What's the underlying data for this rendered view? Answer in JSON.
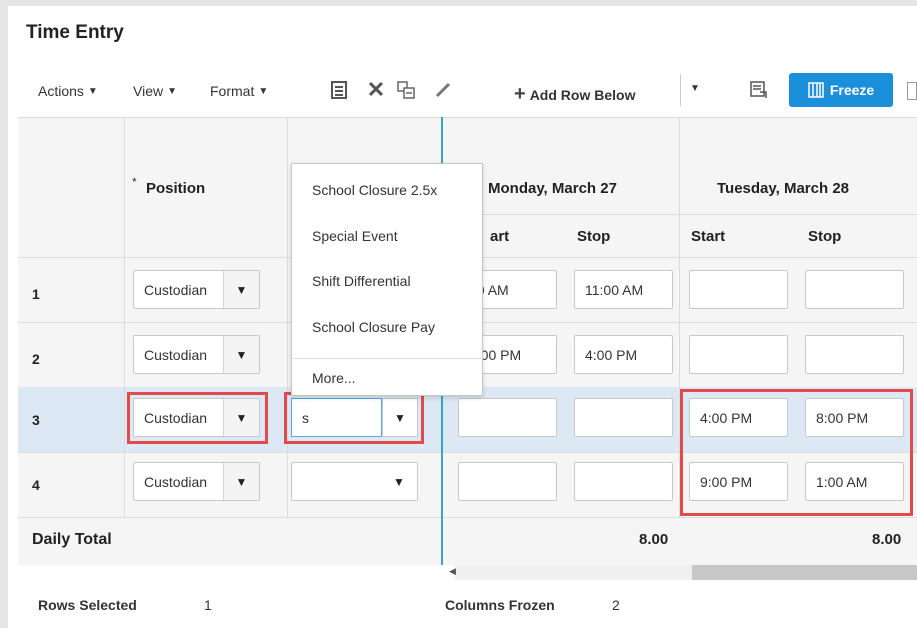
{
  "title": "Time Entry",
  "toolbar": {
    "actions": "Actions",
    "view": "View",
    "format": "Format",
    "add_row_below": "Add Row Below",
    "freeze": "Freeze"
  },
  "table": {
    "position_header": "Position",
    "required_marker": "*",
    "day1": "Monday, March 27",
    "day2": "Tuesday, March 28",
    "start": "Start",
    "stop": "Stop",
    "start_partial": "art",
    "rows": [
      {
        "num": "1",
        "position": "Custodian",
        "mon_start": "00 AM",
        "mon_stop": "11:00 AM",
        "tue_start": "",
        "tue_stop": ""
      },
      {
        "num": "2",
        "position": "Custodian",
        "mon_start": "2:00 PM",
        "mon_stop": "4:00 PM",
        "tue_start": "",
        "tue_stop": ""
      },
      {
        "num": "3",
        "position": "Custodian",
        "type_input": "s",
        "mon_start": "",
        "mon_stop": "",
        "tue_start": "4:00 PM",
        "tue_stop": "8:00 PM"
      },
      {
        "num": "4",
        "position": "Custodian",
        "mon_start": "",
        "mon_stop": "",
        "tue_start": "9:00 PM",
        "tue_stop": "1:00 AM"
      }
    ],
    "daily_total_label": "Daily Total",
    "total_mon": "8.00",
    "total_tue": "8.00"
  },
  "dropdown": {
    "items": [
      "School Closure 2.5x",
      "Special Event",
      "Shift Differential",
      "School Closure Pay"
    ],
    "more": "More..."
  },
  "footer": {
    "rows_selected_label": "Rows Selected",
    "rows_selected_value": "1",
    "columns_frozen_label": "Columns Frozen",
    "columns_frozen_value": "2"
  },
  "colors": {
    "accent": "#1b8fd9",
    "highlight": "#e04b4b",
    "selected_row": "#dce8f4",
    "freeze_line": "#35a6c9"
  }
}
